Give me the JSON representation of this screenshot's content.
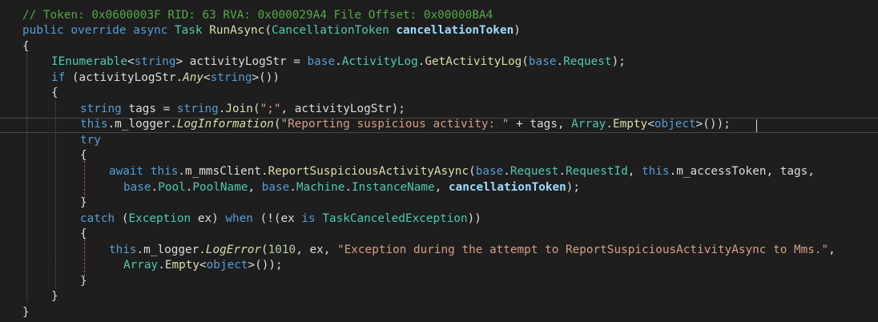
{
  "editor": {
    "lines": [
      {
        "indent": 0,
        "tokens": [
          {
            "c": "tk-comment",
            "t": "// Token: 0x0600003F RID: 63 RVA: 0x000029A4 File Offset: 0x00000BA4"
          }
        ]
      },
      {
        "indent": 0,
        "tokens": [
          {
            "c": "tk-kw",
            "t": "public"
          },
          {
            "c": "tk-plain",
            "t": " "
          },
          {
            "c": "tk-kw",
            "t": "override"
          },
          {
            "c": "tk-plain",
            "t": " "
          },
          {
            "c": "tk-kw",
            "t": "async"
          },
          {
            "c": "tk-plain",
            "t": " "
          },
          {
            "c": "tk-type",
            "t": "Task"
          },
          {
            "c": "tk-plain",
            "t": " "
          },
          {
            "c": "tk-fn",
            "t": "RunAsync"
          },
          {
            "c": "tk-plain",
            "t": "("
          },
          {
            "c": "tk-type",
            "t": "CancellationToken"
          },
          {
            "c": "tk-plain",
            "t": " "
          },
          {
            "c": "tk-param",
            "t": "cancellationToken"
          },
          {
            "c": "tk-plain",
            "t": ")"
          }
        ]
      },
      {
        "indent": 0,
        "tokens": [
          {
            "c": "tk-plain",
            "t": "{"
          }
        ]
      },
      {
        "indent": 1,
        "tokens": [
          {
            "c": "tk-type",
            "t": "IEnumerable"
          },
          {
            "c": "tk-plain",
            "t": "<"
          },
          {
            "c": "tk-kw",
            "t": "string"
          },
          {
            "c": "tk-plain",
            "t": "> activityLogStr = "
          },
          {
            "c": "tk-kw",
            "t": "base"
          },
          {
            "c": "tk-plain",
            "t": "."
          },
          {
            "c": "tk-prop",
            "t": "ActivityLog"
          },
          {
            "c": "tk-plain",
            "t": "."
          },
          {
            "c": "tk-fn",
            "t": "GetActivityLog"
          },
          {
            "c": "tk-plain",
            "t": "("
          },
          {
            "c": "tk-kw",
            "t": "base"
          },
          {
            "c": "tk-plain",
            "t": "."
          },
          {
            "c": "tk-prop",
            "t": "Request"
          },
          {
            "c": "tk-plain",
            "t": ");"
          }
        ]
      },
      {
        "indent": 1,
        "tokens": [
          {
            "c": "tk-kw",
            "t": "if"
          },
          {
            "c": "tk-plain",
            "t": " (activityLogStr."
          },
          {
            "c": "tk-ext",
            "t": "Any"
          },
          {
            "c": "tk-plain",
            "t": "<"
          },
          {
            "c": "tk-kw",
            "t": "string"
          },
          {
            "c": "tk-plain",
            "t": ">())"
          }
        ]
      },
      {
        "indent": 1,
        "tokens": [
          {
            "c": "tk-plain",
            "t": "{"
          }
        ]
      },
      {
        "indent": 2,
        "tokens": [
          {
            "c": "tk-kw",
            "t": "string"
          },
          {
            "c": "tk-plain",
            "t": " tags = "
          },
          {
            "c": "tk-kw",
            "t": "string"
          },
          {
            "c": "tk-plain",
            "t": "."
          },
          {
            "c": "tk-fn",
            "t": "Join"
          },
          {
            "c": "tk-plain",
            "t": "("
          },
          {
            "c": "tk-str",
            "t": "\";\""
          },
          {
            "c": "tk-plain",
            "t": ", activityLogStr);"
          }
        ]
      },
      {
        "indent": 2,
        "tokens": [
          {
            "c": "tk-kw",
            "t": "this"
          },
          {
            "c": "tk-plain",
            "t": ".m_logger."
          },
          {
            "c": "tk-ext",
            "t": "LogInformation"
          },
          {
            "c": "tk-plain",
            "t": "("
          },
          {
            "c": "tk-str",
            "t": "\"Reporting suspicious activity: \""
          },
          {
            "c": "tk-plain",
            "t": " + tags, "
          },
          {
            "c": "tk-type",
            "t": "Array"
          },
          {
            "c": "tk-plain",
            "t": "."
          },
          {
            "c": "tk-fn",
            "t": "Empty"
          },
          {
            "c": "tk-plain",
            "t": "<"
          },
          {
            "c": "tk-kw",
            "t": "object"
          },
          {
            "c": "tk-plain",
            "t": ">());"
          }
        ]
      },
      {
        "indent": 2,
        "tokens": [
          {
            "c": "tk-kw",
            "t": "try"
          }
        ]
      },
      {
        "indent": 2,
        "tokens": [
          {
            "c": "tk-plain",
            "t": "{"
          }
        ]
      },
      {
        "indent": 3,
        "tokens": [
          {
            "c": "tk-kw",
            "t": "await"
          },
          {
            "c": "tk-plain",
            "t": " "
          },
          {
            "c": "tk-kw",
            "t": "this"
          },
          {
            "c": "tk-plain",
            "t": ".m_mmsClient."
          },
          {
            "c": "tk-fn",
            "t": "ReportSuspiciousActivityAsync"
          },
          {
            "c": "tk-plain",
            "t": "("
          },
          {
            "c": "tk-kw",
            "t": "base"
          },
          {
            "c": "tk-plain",
            "t": "."
          },
          {
            "c": "tk-prop",
            "t": "Request"
          },
          {
            "c": "tk-plain",
            "t": "."
          },
          {
            "c": "tk-prop",
            "t": "RequestId"
          },
          {
            "c": "tk-plain",
            "t": ", "
          },
          {
            "c": "tk-kw",
            "t": "this"
          },
          {
            "c": "tk-plain",
            "t": ".m_accessToken, tags,"
          }
        ]
      },
      {
        "indent": 3.5,
        "tokens": [
          {
            "c": "tk-kw",
            "t": "base"
          },
          {
            "c": "tk-plain",
            "t": "."
          },
          {
            "c": "tk-prop",
            "t": "Pool"
          },
          {
            "c": "tk-plain",
            "t": "."
          },
          {
            "c": "tk-prop",
            "t": "PoolName"
          },
          {
            "c": "tk-plain",
            "t": ", "
          },
          {
            "c": "tk-kw",
            "t": "base"
          },
          {
            "c": "tk-plain",
            "t": "."
          },
          {
            "c": "tk-prop",
            "t": "Machine"
          },
          {
            "c": "tk-plain",
            "t": "."
          },
          {
            "c": "tk-prop",
            "t": "InstanceName"
          },
          {
            "c": "tk-plain",
            "t": ", "
          },
          {
            "c": "tk-param",
            "t": "cancellationToken"
          },
          {
            "c": "tk-plain",
            "t": ");"
          }
        ]
      },
      {
        "indent": 2,
        "tokens": [
          {
            "c": "tk-plain",
            "t": "}"
          }
        ]
      },
      {
        "indent": 2,
        "tokens": [
          {
            "c": "tk-kw",
            "t": "catch"
          },
          {
            "c": "tk-plain",
            "t": " ("
          },
          {
            "c": "tk-type",
            "t": "Exception"
          },
          {
            "c": "tk-plain",
            "t": " ex) "
          },
          {
            "c": "tk-kw",
            "t": "when"
          },
          {
            "c": "tk-plain",
            "t": " (!(ex "
          },
          {
            "c": "tk-kw",
            "t": "is"
          },
          {
            "c": "tk-plain",
            "t": " "
          },
          {
            "c": "tk-type",
            "t": "TaskCanceledException"
          },
          {
            "c": "tk-plain",
            "t": "))"
          }
        ]
      },
      {
        "indent": 2,
        "tokens": [
          {
            "c": "tk-plain",
            "t": "{"
          }
        ]
      },
      {
        "indent": 3,
        "tokens": [
          {
            "c": "tk-kw",
            "t": "this"
          },
          {
            "c": "tk-plain",
            "t": ".m_logger."
          },
          {
            "c": "tk-ext",
            "t": "LogError"
          },
          {
            "c": "tk-plain",
            "t": "("
          },
          {
            "c": "tk-num",
            "t": "1010"
          },
          {
            "c": "tk-plain",
            "t": ", ex, "
          },
          {
            "c": "tk-str",
            "t": "\"Exception during the attempt to ReportSuspiciousActivityAsync to Mms.\""
          },
          {
            "c": "tk-plain",
            "t": ","
          }
        ]
      },
      {
        "indent": 3.5,
        "tokens": [
          {
            "c": "tk-type",
            "t": "Array"
          },
          {
            "c": "tk-plain",
            "t": "."
          },
          {
            "c": "tk-fn",
            "t": "Empty"
          },
          {
            "c": "tk-plain",
            "t": "<"
          },
          {
            "c": "tk-kw",
            "t": "object"
          },
          {
            "c": "tk-plain",
            "t": ">());"
          }
        ]
      },
      {
        "indent": 2,
        "tokens": [
          {
            "c": "tk-plain",
            "t": "}"
          }
        ]
      },
      {
        "indent": 1,
        "tokens": [
          {
            "c": "tk-plain",
            "t": "}"
          }
        ]
      },
      {
        "indent": 0,
        "tokens": [
          {
            "c": "tk-plain",
            "t": "}"
          }
        ]
      }
    ]
  }
}
